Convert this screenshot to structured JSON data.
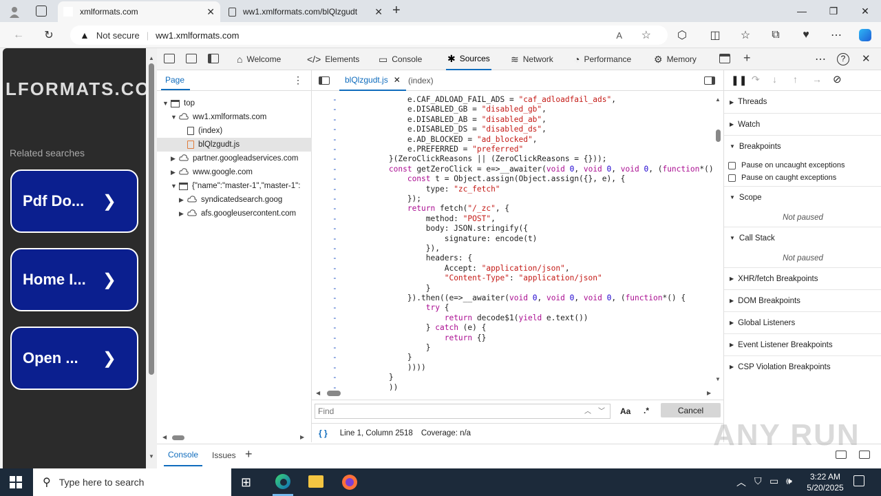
{
  "browser": {
    "tabs": [
      {
        "title": "xmlformats.com",
        "active": true
      },
      {
        "title": "ww1.xmlformats.com/blQlzgudt",
        "active": false
      }
    ],
    "security_label": "Not secure",
    "url": "ww1.xmlformats.com"
  },
  "page": {
    "logo_text": "LFORMATS.CO",
    "related_label": "Related searches",
    "buttons": [
      "Pdf Do...",
      "Home I...",
      "Open ..."
    ]
  },
  "devtools": {
    "tabs": [
      "Welcome",
      "Elements",
      "Console",
      "Sources",
      "Network",
      "Performance",
      "Memory"
    ],
    "active_tab": "Sources",
    "navigator_tab": "Page",
    "tree": [
      {
        "label": "top",
        "indent": 0,
        "arrow": "▼",
        "icon": "frame"
      },
      {
        "label": "ww1.xmlformats.com",
        "indent": 1,
        "arrow": "▼",
        "icon": "cloud"
      },
      {
        "label": "(index)",
        "indent": 2,
        "arrow": "",
        "icon": "file"
      },
      {
        "label": "blQlzgudt.js",
        "indent": 2,
        "arrow": "",
        "icon": "jsfile",
        "selected": true
      },
      {
        "label": "partner.googleadservices.com",
        "indent": 1,
        "arrow": "▶",
        "icon": "cloud"
      },
      {
        "label": "www.google.com",
        "indent": 1,
        "arrow": "▶",
        "icon": "cloud"
      },
      {
        "label": "{\"name\":\"master-1\",\"master-1\":",
        "indent": 1,
        "arrow": "▼",
        "icon": "frame"
      },
      {
        "label": "syndicatedsearch.goog",
        "indent": 2,
        "arrow": "▶",
        "icon": "cloud"
      },
      {
        "label": "afs.googleusercontent.com",
        "indent": 2,
        "arrow": "▶",
        "icon": "cloud"
      }
    ],
    "editor_tabs": [
      {
        "label": "blQlzgudt.js",
        "active": true
      },
      {
        "label": "(index)",
        "active": false
      }
    ],
    "code_lines": [
      "            e.CAF_ADLOAD_FAIL_ADS = \"caf_adloadfail_ads\",",
      "            e.DISABLED_GB = \"disabled_gb\",",
      "            e.DISABLED_AB = \"disabled_ab\",",
      "            e.DISABLED_DS = \"disabled_ds\",",
      "            e.AD_BLOCKED = \"ad_blocked\",",
      "            e.PREFERRED = \"preferred\"",
      "        }(ZeroClickReasons || (ZeroClickReasons = {}));",
      "        const getZeroClick = e=>__awaiter(void 0, void 0, void 0, (function*()",
      "            const t = Object.assign(Object.assign({}, e), {",
      "                type: \"zc_fetch\"",
      "            });",
      "            return fetch(\"/_zc\", {",
      "                method: \"POST\",",
      "                body: JSON.stringify({",
      "                    signature: encode(t)",
      "                }),",
      "                headers: {",
      "                    Accept: \"application/json\",",
      "                    \"Content-Type\": \"application/json\"",
      "                }",
      "            }).then((e=>__awaiter(void 0, void 0, void 0, (function*() {",
      "                try {",
      "                    return decode$1(yield e.text())",
      "                } catch (e) {",
      "                    return {}",
      "                }",
      "            }",
      "            ))))",
      "        }",
      "        ))"
    ],
    "find_placeholder": "Find",
    "match_case": "Aa",
    "regex": ".*",
    "cancel_label": "Cancel",
    "status": "Line 1, Column 2518",
    "coverage": "Coverage: n/a",
    "debugger": {
      "threads": "Threads",
      "watch": "Watch",
      "breakpoints": "Breakpoints",
      "pause_uncaught": "Pause on uncaught exceptions",
      "pause_caught": "Pause on caught exceptions",
      "scope": "Scope",
      "not_paused": "Not paused",
      "call_stack": "Call Stack",
      "xhr": "XHR/fetch Breakpoints",
      "dom": "DOM Breakpoints",
      "global": "Global Listeners",
      "event": "Event Listener Breakpoints",
      "csp": "CSP Violation Breakpoints"
    },
    "drawer_tabs": [
      "Console",
      "Issues"
    ]
  },
  "taskbar": {
    "search_placeholder": "Type here to search",
    "time": "3:22 AM",
    "date": "5/20/2025"
  },
  "watermark": "ANY RUN"
}
